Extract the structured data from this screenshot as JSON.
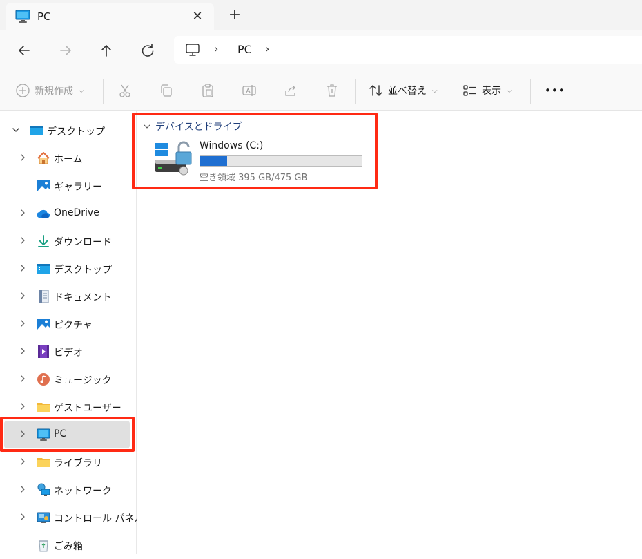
{
  "window": {
    "tab_title": "PC",
    "tab_close_glyph": "✕",
    "new_tab_glyph": "+"
  },
  "address": {
    "location": "PC",
    "chevron": "›"
  },
  "commands": {
    "new": "新規作成",
    "sort": "並べ替え",
    "view": "表示",
    "more": "•••"
  },
  "sidebar": {
    "items": [
      {
        "label": "デスクトップ",
        "icon": "desktop-icon"
      },
      {
        "label": "ホーム",
        "icon": "home-icon"
      },
      {
        "label": "ギャラリー",
        "icon": "gallery-icon"
      },
      {
        "label": "OneDrive",
        "icon": "onedrive-icon"
      },
      {
        "label": "ダウンロード",
        "icon": "download-icon"
      },
      {
        "label": "デスクトップ",
        "icon": "desktop-icon"
      },
      {
        "label": "ドキュメント",
        "icon": "document-icon"
      },
      {
        "label": "ピクチャ",
        "icon": "pictures-icon"
      },
      {
        "label": "ビデオ",
        "icon": "video-icon"
      },
      {
        "label": "ミュージック",
        "icon": "music-icon"
      },
      {
        "label": "ゲストユーザー",
        "icon": "folder-icon"
      },
      {
        "label": "PC",
        "icon": "pc-icon"
      },
      {
        "label": "ライブラリ",
        "icon": "library-folder-icon"
      },
      {
        "label": "ネットワーク",
        "icon": "network-icon"
      },
      {
        "label": "コントロール パネル",
        "icon": "control-panel-icon"
      },
      {
        "label": "ごみ箱",
        "icon": "recycle-bin-icon"
      }
    ]
  },
  "main": {
    "group_title": "デバイスとドライブ",
    "drive": {
      "name": "Windows (C:)",
      "space_text": "空き領域 395 GB/475 GB",
      "used_fraction": 0.168
    }
  },
  "colors": {
    "accent": "#1f6fd1",
    "highlight": "#ff2a14",
    "group_header": "#1f3e7a"
  }
}
